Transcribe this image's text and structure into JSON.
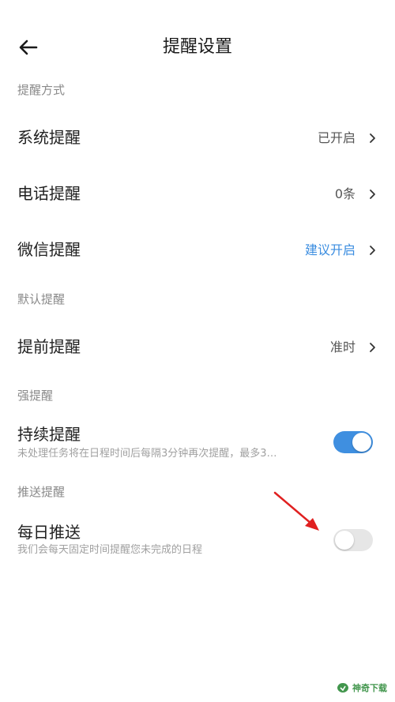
{
  "header": {
    "title": "提醒设置",
    "back_icon": "arrow-left-icon"
  },
  "sections": {
    "mode": {
      "label": "提醒方式"
    },
    "default": {
      "label": "默认提醒"
    },
    "strong": {
      "label": "强提醒"
    },
    "push": {
      "label": "推送提醒"
    }
  },
  "rows": {
    "system": {
      "title": "系统提醒",
      "value": "已开启"
    },
    "phone": {
      "title": "电话提醒",
      "value": "0条"
    },
    "wechat": {
      "title": "微信提醒",
      "value": "建议开启"
    },
    "advance": {
      "title": "提前提醒",
      "value": "准时"
    },
    "continuous": {
      "title": "持续提醒",
      "subtitle": "未处理任务将在日程时间后每隔3分钟再次提醒，最多3…",
      "toggle_on": true
    },
    "daily": {
      "title": "每日推送",
      "subtitle": "我们会每天固定时间提醒您未完成的日程",
      "toggle_on": false
    }
  },
  "watermark": {
    "text": "神奇下载"
  },
  "colors": {
    "accent": "#3b8de0",
    "toggle_on": "#3f8fe0",
    "toggle_off": "#e6e6e6",
    "annotation_arrow": "#e02020"
  }
}
